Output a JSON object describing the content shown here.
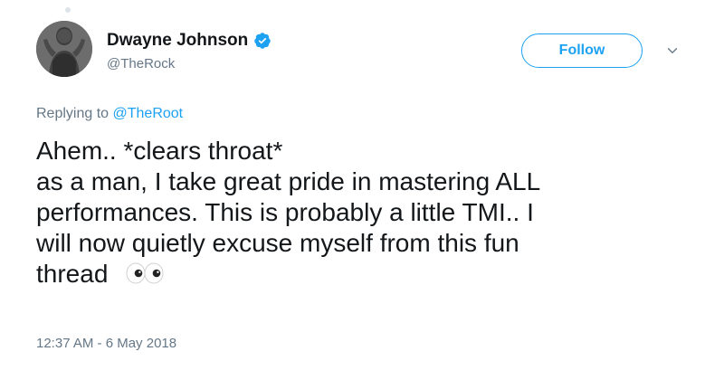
{
  "author": {
    "display_name": "Dwayne Johnson",
    "handle": "@TheRock",
    "verified_icon": "verified-badge-icon"
  },
  "actions": {
    "follow_label": "Follow",
    "more_icon": "chevron-down-icon"
  },
  "reply": {
    "prefix": "Replying to",
    "target": "@TheRoot"
  },
  "tweet": {
    "lines": [
      "Ahem.. *clears throat*",
      "as a man, I take great pride in mastering ALL",
      "performances. This is probably a little TMI.. I",
      "will now quietly excuse myself from this fun",
      "thread"
    ],
    "emoji_icon": "eyes-emoji-icon"
  },
  "meta": {
    "timestamp": "12:37 AM - 6 May 2018"
  },
  "colors": {
    "accent": "#1da1f2",
    "text": "#14171a",
    "muted": "#657786"
  }
}
